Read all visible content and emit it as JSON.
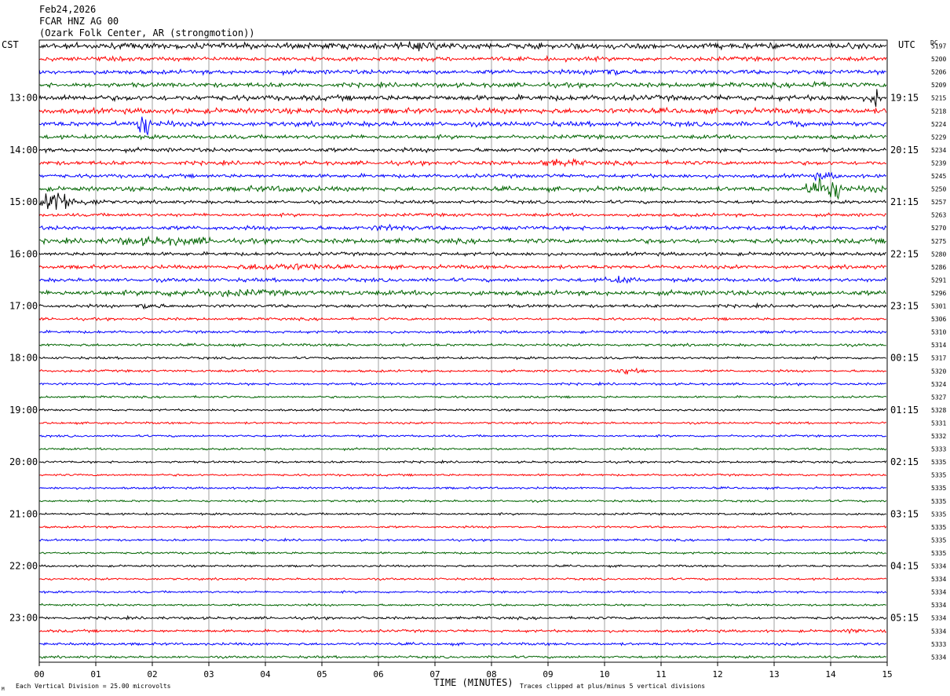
{
  "header": {
    "date": "Feb24,2026",
    "station": "FCAR HNZ AG 00",
    "location": "(Ozark Folk Center, AR (strongmotion))"
  },
  "labels": {
    "left_tz": "CST",
    "right_tz": "UTC",
    "dc_label": "DC",
    "xlabel": "TIME (MINUTES)",
    "scale_note": "Each Vertical Division =   25.00 microvolts",
    "clip_note": "Traces clipped at plus/minus 5 vertical divisions",
    "corner_mark": "M"
  },
  "colors": {
    "trace_cycle": [
      "#000000",
      "#ff0000",
      "#0000ff",
      "#006400"
    ],
    "grid": "#8a8a8a",
    "frame": "#000000"
  },
  "chart_data": {
    "type": "line",
    "title": "FCAR HNZ AG 00",
    "xlabel": "TIME (MINUTES)",
    "xlim": [
      0,
      15
    ],
    "x_ticks": [
      "00",
      "01",
      "02",
      "03",
      "04",
      "05",
      "06",
      "07",
      "08",
      "09",
      "10",
      "11",
      "12",
      "13",
      "14",
      "15"
    ],
    "left_hour_labels": [
      "13:00",
      "14:00",
      "15:00",
      "16:00",
      "17:00",
      "18:00",
      "19:00",
      "20:00",
      "21:00",
      "22:00",
      "23:00"
    ],
    "right_hour_labels": [
      "19:15",
      "20:15",
      "21:15",
      "22:15",
      "23:15",
      "00:15",
      "01:15",
      "02:15",
      "03:15",
      "04:15",
      "05:15"
    ],
    "trace_count": 48,
    "traces_per_hour": 4,
    "minutes_per_trace": 15,
    "dc_offsets": [
      "5197",
      "5200",
      "5206",
      "5209",
      "5215",
      "5218",
      "5224",
      "5229",
      "5234",
      "5239",
      "5245",
      "5250",
      "5257",
      "5263",
      "5270",
      "5275",
      "5280",
      "5286",
      "5291",
      "5296",
      "5301",
      "5306",
      "5310",
      "5314",
      "5317",
      "5320",
      "5324",
      "5327",
      "5328",
      "5331",
      "5332",
      "5333",
      "5335",
      "5335",
      "5335",
      "5335",
      "5335",
      "5335",
      "5335",
      "5335",
      "5334",
      "5334",
      "5334",
      "5334",
      "5334",
      "5334",
      "5333",
      "5334"
    ],
    "noise_levels": [
      2.2,
      1.6,
      1.6,
      1.7,
      2.0,
      2.0,
      1.8,
      1.5,
      1.5,
      1.5,
      1.4,
      1.7,
      1.2,
      1.2,
      1.5,
      1.8,
      1.3,
      1.4,
      1.4,
      1.8,
      1.2,
      1.0,
      1.0,
      1.0,
      0.9,
      0.9,
      0.9,
      0.8,
      0.8,
      0.8,
      0.8,
      0.8,
      0.8,
      0.8,
      0.8,
      0.8,
      0.8,
      0.8,
      0.8,
      0.8,
      0.8,
      0.8,
      0.8,
      0.8,
      1.0,
      1.0,
      1.0,
      0.9
    ],
    "events": [
      {
        "trace": 0,
        "start_min": 6.0,
        "end_min": 9.0,
        "amp_div": 3.5
      },
      {
        "trace": 2,
        "start_min": 9.5,
        "end_min": 11.5,
        "amp_div": 3.5
      },
      {
        "trace": 3,
        "start_min": 13.5,
        "end_min": 14.3,
        "amp_div": 4
      },
      {
        "trace": 4,
        "start_min": 14.7,
        "end_min": 15.0,
        "amp_div": 10
      },
      {
        "trace": 4,
        "start_min": 0.3,
        "end_min": 0.8,
        "amp_div": 3
      },
      {
        "trace": 6,
        "start_min": 1.6,
        "end_min": 2.4,
        "amp_div": 10
      },
      {
        "trace": 6,
        "start_min": 13.2,
        "end_min": 13.7,
        "amp_div": 4
      },
      {
        "trace": 9,
        "start_min": 8.5,
        "end_min": 11.0,
        "amp_div": 3
      },
      {
        "trace": 10,
        "start_min": 13.4,
        "end_min": 15.0,
        "amp_div": 3
      },
      {
        "trace": 11,
        "start_min": 13.5,
        "end_min": 15.0,
        "amp_div": 10
      },
      {
        "trace": 11,
        "start_min": 3.0,
        "end_min": 7.5,
        "amp_div": 2.5
      },
      {
        "trace": 12,
        "start_min": 0.0,
        "end_min": 1.2,
        "amp_div": 10
      },
      {
        "trace": 14,
        "start_min": 5.5,
        "end_min": 8.0,
        "amp_div": 2.5
      },
      {
        "trace": 15,
        "start_min": 0.5,
        "end_min": 6.5,
        "amp_div": 3.5
      },
      {
        "trace": 17,
        "start_min": 3.0,
        "end_min": 7.8,
        "amp_div": 3
      },
      {
        "trace": 18,
        "start_min": 9.8,
        "end_min": 11.5,
        "amp_div": 3
      },
      {
        "trace": 19,
        "start_min": 1.0,
        "end_min": 8.5,
        "amp_div": 3
      },
      {
        "trace": 20,
        "start_min": 1.6,
        "end_min": 2.8,
        "amp_div": 3
      },
      {
        "trace": 25,
        "start_min": 10.0,
        "end_min": 11.5,
        "amp_div": 3
      },
      {
        "trace": 45,
        "start_min": 14.2,
        "end_min": 15.0,
        "amp_div": 2.5
      }
    ]
  }
}
